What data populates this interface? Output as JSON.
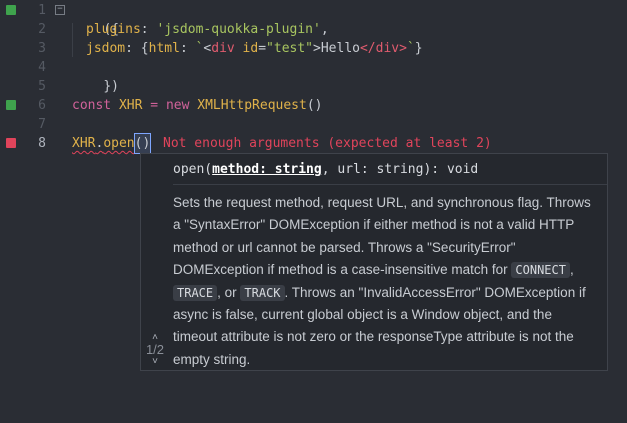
{
  "gutter": {
    "line_numbers": [
      "1",
      "2",
      "3",
      "4",
      "5",
      "6",
      "7",
      "8"
    ],
    "fold_symbol": "⊟"
  },
  "code": {
    "line1": "({",
    "line2_key": "plugins",
    "line2_colon": ": ",
    "line2_value": "'jsdom-quokka-plugin'",
    "line2_comma": ",",
    "line3_key": "jsdom",
    "line3_pre": ": {",
    "line3_html": "html",
    "line3_colon": ": ",
    "line3_tick_open": "`",
    "line3_lt": "<",
    "line3_tag": "div",
    "line3_attr": " id",
    "line3_eq": "=",
    "line3_val": "\"test\"",
    "line3_gt": ">",
    "line3_text": "Hello",
    "line3_close": "</div>",
    "line3_tick_close": "`",
    "line3_end": "}",
    "line4": "})",
    "line6_kw": "const",
    "line6_var": " XHR",
    "line6_eq": " = ",
    "line6_new": "new",
    "line6_type": " XMLHttpRequest",
    "line6_call": "()",
    "line8_obj": "XHR",
    "line8_dot": ".",
    "line8_method": "open",
    "line8_paren_open": "(",
    "line8_paren_close": ")"
  },
  "error": {
    "message": "Not enough arguments (expected at least 2)"
  },
  "tooltip": {
    "sig_prefix": "open(",
    "sig_active": "method: string",
    "sig_rest": ", url: string): void",
    "doc_part1": "Sets the request method, request URL, and synchronous flag. Throws a \"SyntaxError\" DOMException if either method is not a valid HTTP method or url cannot be parsed. Throws a \"SecurityError\" DOMException if method is a case-insensitive match for ",
    "code1": "CONNECT",
    "sep1": ", ",
    "code2": "TRACE",
    "sep2": ", or ",
    "code3": "TRACK",
    "doc_part2": ". Throws an \"InvalidAccessError\" DOMException if async is false, current global object is a Window object, and the timeout attribute is not zero or the responseType attribute is not the empty string.",
    "pager_up": "˄",
    "pager_count": "1/2",
    "pager_down": "˅"
  },
  "colors": {
    "background": "#2a2d34",
    "gutter_green": "#3fa34d",
    "gutter_red": "#e0445b",
    "error_text": "#e0445b",
    "keyword": "#d1629a",
    "string": "#a8c560",
    "property": "#e0b24a"
  }
}
